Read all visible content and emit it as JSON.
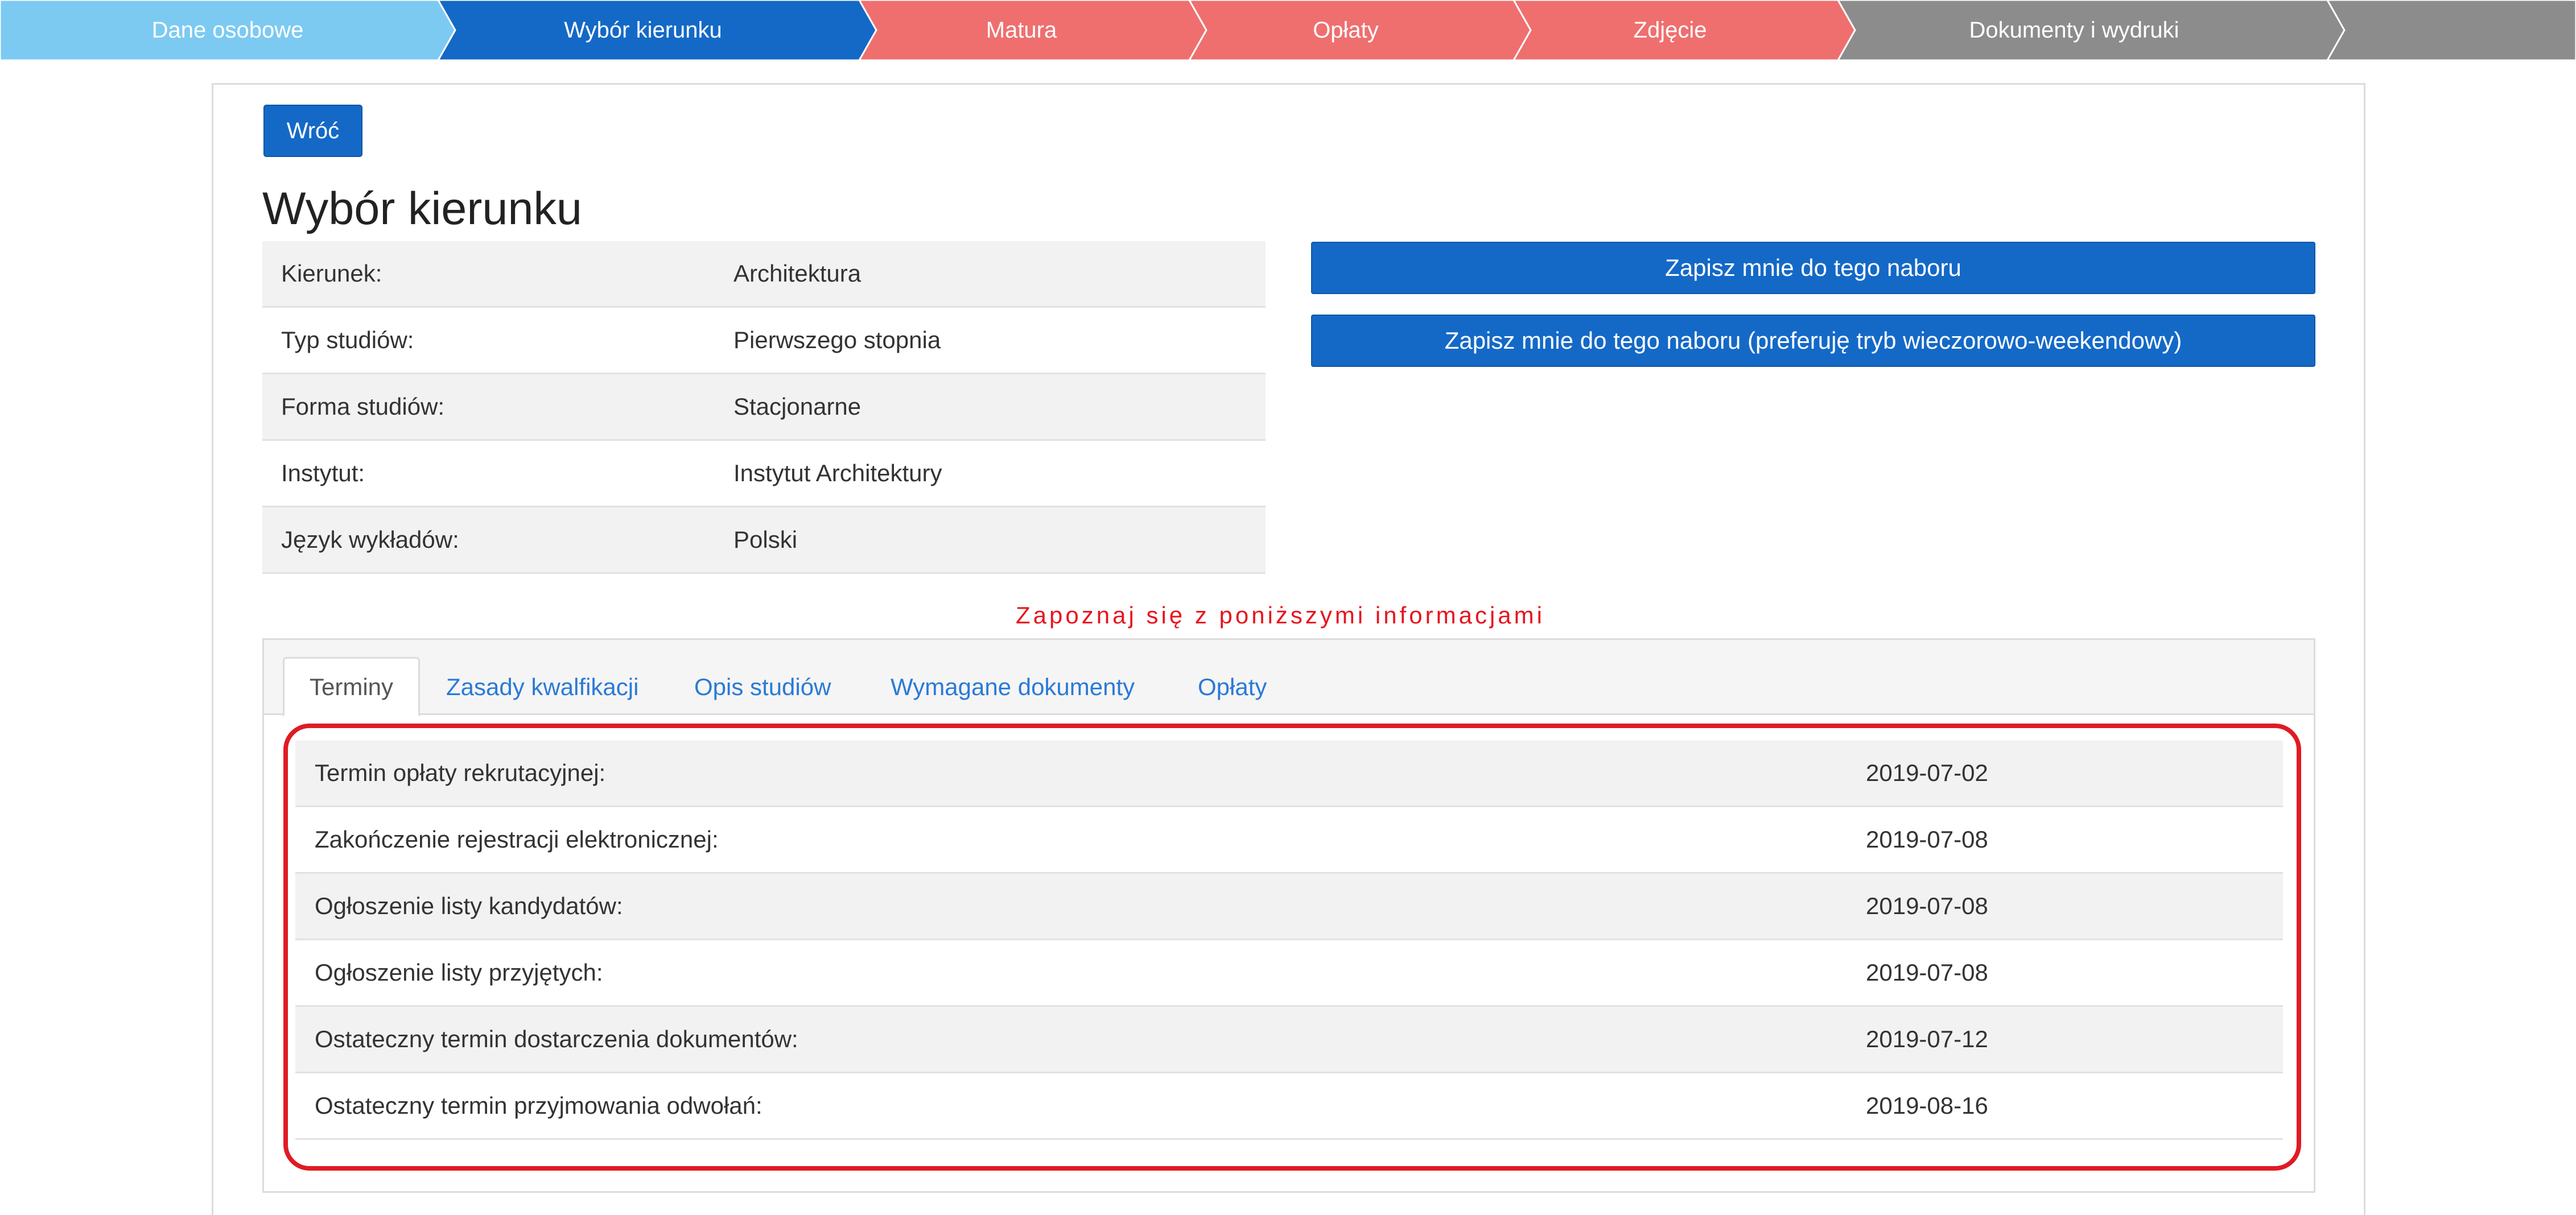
{
  "steps": [
    {
      "label": "Dane osobowe",
      "color": "#7ccaf2"
    },
    {
      "label": "Wybór kierunku",
      "color": "#1469c7"
    },
    {
      "label": "Matura",
      "color": "#ef6f6f"
    },
    {
      "label": "Opłaty",
      "color": "#ef6f6f"
    },
    {
      "label": "Zdjęcie",
      "color": "#ef6f6f"
    },
    {
      "label": "Dokumenty i wydruki",
      "color": "#8c8c8c"
    },
    {
      "label": "",
      "color": "#8c8c8c"
    }
  ],
  "back_button": "Wróć",
  "page_title": "Wybór kierunku",
  "info": [
    {
      "key": "Kierunek:",
      "value": "Architektura"
    },
    {
      "key": "Typ studiów:",
      "value": "Pierwszego stopnia"
    },
    {
      "key": "Forma studiów:",
      "value": "Stacjonarne"
    },
    {
      "key": "Instytut:",
      "value": "Instytut Architektury"
    },
    {
      "key": "Język wykładów:",
      "value": "Polski"
    }
  ],
  "actions": {
    "enroll": "Zapisz mnie do tego naboru",
    "enroll_evening": "Zapisz mnie do tego naboru (preferuję tryb wieczorowo-weekendowy)"
  },
  "notice": "Zapoznaj się z poniższymi informacjami",
  "tabs": [
    {
      "label": "Terminy",
      "active": true
    },
    {
      "label": "Zasady kwalfikacji",
      "active": false
    },
    {
      "label": "Opis studiów",
      "active": false
    },
    {
      "label": "Wymagane dokumenty",
      "active": false
    },
    {
      "label": "Opłaty",
      "active": false
    }
  ],
  "dates": [
    {
      "label": "Termin opłaty rekrutacyjnej:",
      "date": "2019-07-02"
    },
    {
      "label": "Zakończenie rejestracji elektronicznej:",
      "date": "2019-07-08"
    },
    {
      "label": "Ogłoszenie listy kandydatów:",
      "date": "2019-07-08"
    },
    {
      "label": "Ogłoszenie listy przyjętych:",
      "date": "2019-07-08"
    },
    {
      "label": "Ostateczny termin dostarczenia dokumentów:",
      "date": "2019-07-12"
    },
    {
      "label": "Ostateczny termin przyjmowania odwołań:",
      "date": "2019-08-16"
    }
  ],
  "colors": {
    "primary": "#1469c7",
    "highlight": "#e01b24",
    "notice": "#e8141e",
    "link": "#2a7ad6"
  }
}
